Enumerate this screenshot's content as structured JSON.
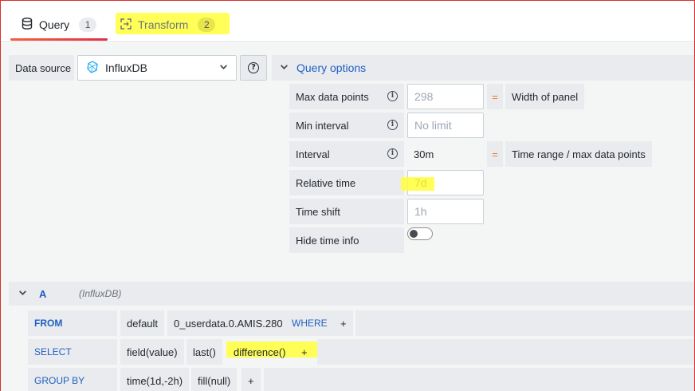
{
  "tabs": [
    {
      "label": "Query",
      "count": "1",
      "active": true
    },
    {
      "label": "Transform",
      "count": "2",
      "active": false
    }
  ],
  "datasource": {
    "label": "Data source",
    "selected": "InfluxDB"
  },
  "query_options": {
    "title": "Query options",
    "max_data_points": {
      "label": "Max data points",
      "placeholder": "298",
      "equals": "=",
      "desc": "Width of panel"
    },
    "min_interval": {
      "label": "Min interval",
      "placeholder": "No limit"
    },
    "interval": {
      "label": "Interval",
      "value": "30m",
      "equals": "=",
      "desc": "Time range / max data points"
    },
    "relative_time": {
      "label": "Relative time",
      "value": "7d"
    },
    "time_shift": {
      "label": "Time shift",
      "placeholder": "1h"
    },
    "hide_time_info": {
      "label": "Hide time info",
      "enabled": false
    }
  },
  "query_a": {
    "ref": "A",
    "datasource": "(InfluxDB)",
    "from": {
      "keyword": "FROM",
      "policy": "default",
      "measurement": "0_userdata.0.AMIS.280",
      "where": "WHERE",
      "add": "+"
    },
    "select": {
      "keyword": "SELECT",
      "field": "field(value)",
      "fn1": "last()",
      "fn2": "difference()",
      "add": "+"
    },
    "group_by": {
      "keyword": "GROUP BY",
      "time": "time(1d,-2h)",
      "fill": "fill(null)",
      "add": "+"
    }
  },
  "colors": {
    "accent_blue": "#1f60c4",
    "tab_underline": "#e02f44",
    "highlight": "#ffff3a",
    "equals_orange": "#eb7b18"
  }
}
